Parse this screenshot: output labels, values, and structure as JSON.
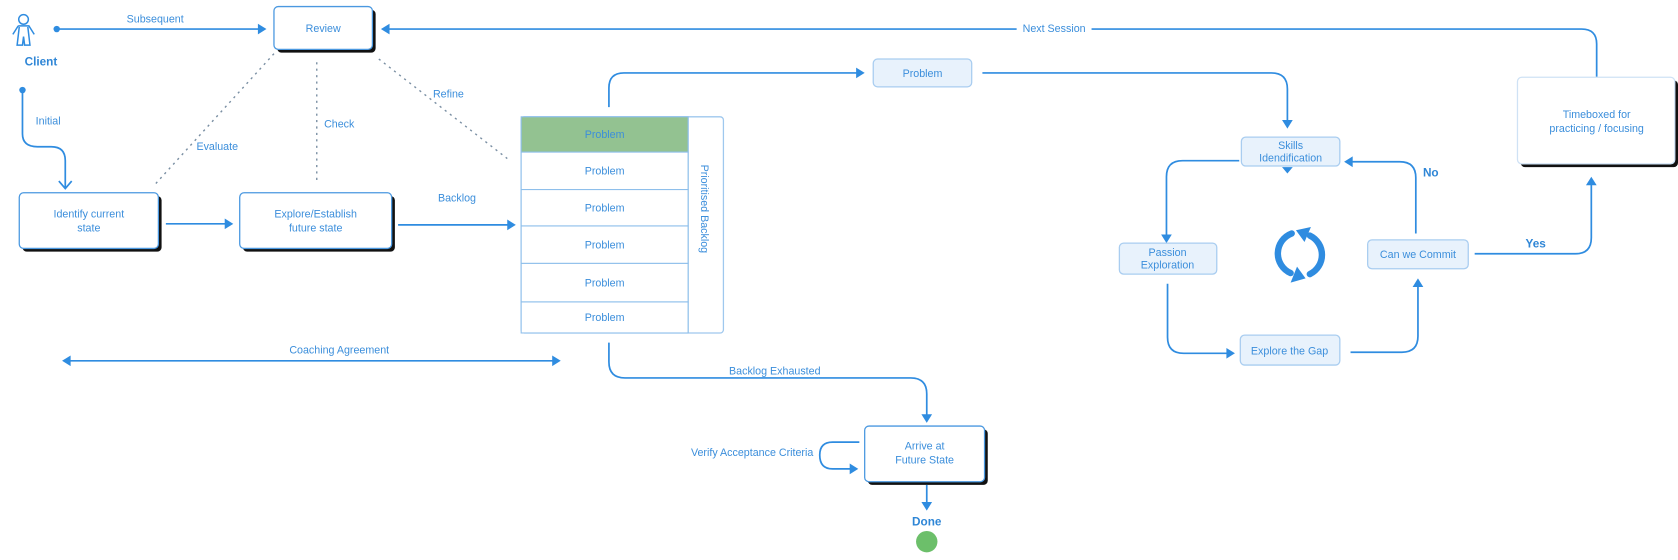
{
  "colors": {
    "line": "#2f8ce0",
    "text": "#3b8edb",
    "highlight_row": "#93c291",
    "done": "#6cbf6a",
    "light_box": "#e8f2fc"
  },
  "actor": {
    "label": "Client",
    "icon": "person-icon"
  },
  "edges": {
    "subsequent": "Subsequent",
    "initial": "Initial",
    "evaluate": "Evaluate",
    "check": "Check",
    "refine": "Refine",
    "backlog": "Backlog",
    "next_session": "Next Session",
    "coaching_agreement": "Coaching Agreement",
    "backlog_exhausted": "Backlog Exhausted",
    "verify": "Verify Acceptance Criteria",
    "no": "No",
    "yes": "Yes"
  },
  "nodes": {
    "review": "Review",
    "identify": [
      "Identify current",
      "state"
    ],
    "explore": [
      "Explore/Establish",
      "future state"
    ],
    "problem_top": "Problem",
    "skills": [
      "Skills",
      "Idendification"
    ],
    "passion": [
      "Passion",
      "Exploration"
    ],
    "gap": "Explore the Gap",
    "commit": "Can we Commit",
    "timeboxed": [
      "Timeboxed for",
      "practicing / focusing"
    ],
    "arrive": [
      "Arrive at",
      "Future State"
    ],
    "done": "Done"
  },
  "backlog": {
    "title": "Prioritised Backlog",
    "rows": [
      "Problem",
      "Problem",
      "Problem",
      "Problem",
      "Problem",
      "Problem"
    ],
    "highlighted_row": 0
  },
  "cycle_icon": "refresh-cycle-icon"
}
